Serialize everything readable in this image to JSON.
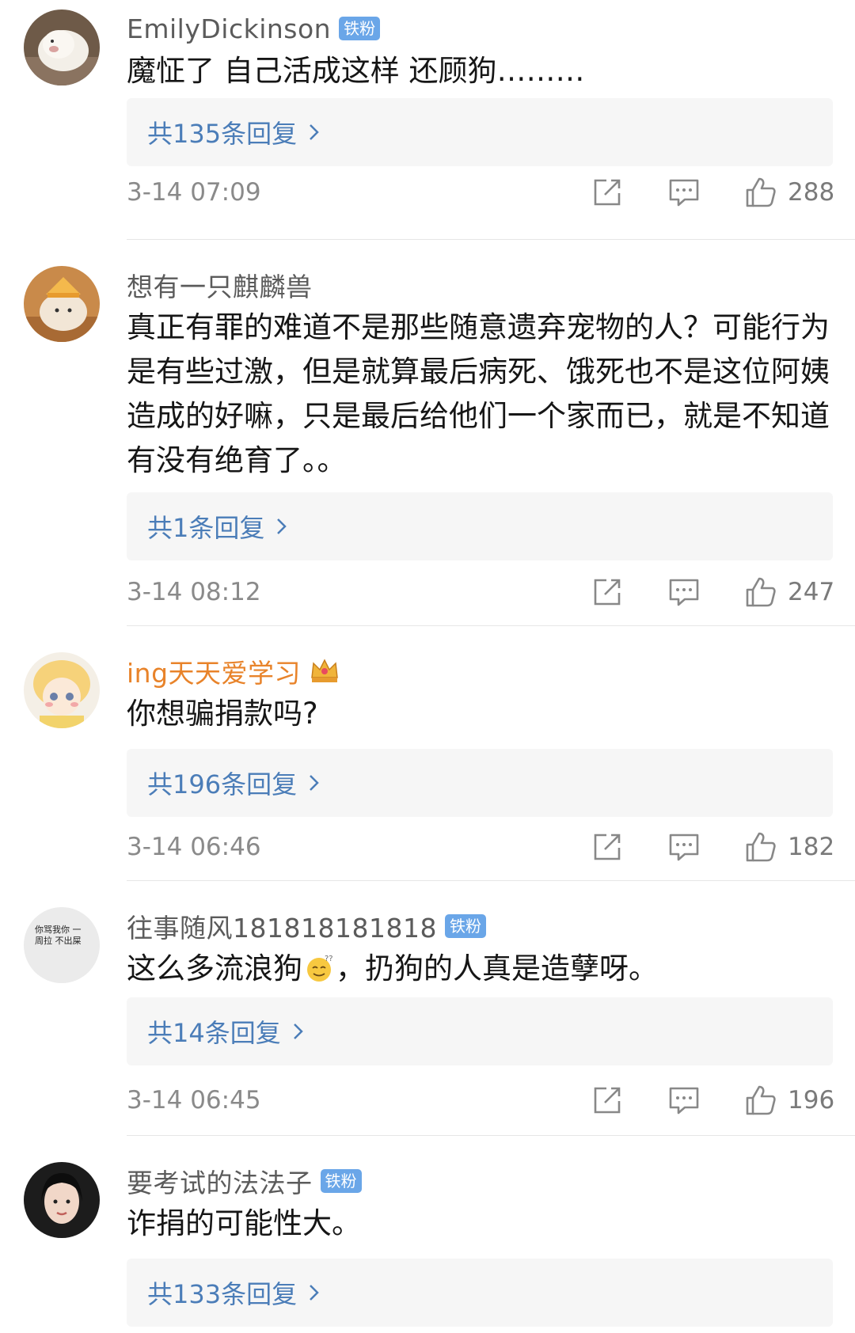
{
  "comments": [
    {
      "username": "EmilyDickinson",
      "badge": "铁粉",
      "content": "魔怔了 自己活成这样 还顾狗………",
      "replies": "共135条回复",
      "timestamp": "3-14 07:09",
      "likes": "288"
    },
    {
      "username": "想有一只麒麟兽",
      "badge": "",
      "content": "真正有罪的难道不是那些随意遗弃宠物的人？可能行为是有些过激，但是就算最后病死、饿死也不是这位阿姨造成的好嘛，只是最后给他们一个家而已，就是不知道有没有绝育了。。",
      "replies": "共1条回复",
      "timestamp": "3-14 08:12",
      "likes": "247"
    },
    {
      "username": "ing天天爱学习",
      "badge": "",
      "content": "你想骗捐款吗?",
      "replies": "共196条回复",
      "timestamp": "3-14 06:46",
      "likes": "182"
    },
    {
      "username": "往事随风181818181818",
      "badge": "铁粉",
      "content_before": "这么多流浪狗",
      "content_after": "，扔狗的人真是造孽呀。",
      "replies": "共14条回复",
      "timestamp": "3-14 06:45",
      "likes": "196"
    },
    {
      "username": "要考试的法法子",
      "badge": "铁粉",
      "content": "诈捐的可能性大。",
      "replies": "共133条回复",
      "timestamp": "",
      "likes": ""
    }
  ],
  "avatar4_text": "你骂我你 一周拉 不出屎",
  "icons": {
    "share": "share-icon",
    "comment": "comment-icon",
    "like": "thumbs-up-icon",
    "chevron": "chevron-right-icon"
  },
  "colors": {
    "reply_link": "#4b7db8",
    "badge_bg": "#6aa6e8",
    "vip_name": "#e8832a",
    "meta_text": "#8a8a8a"
  }
}
